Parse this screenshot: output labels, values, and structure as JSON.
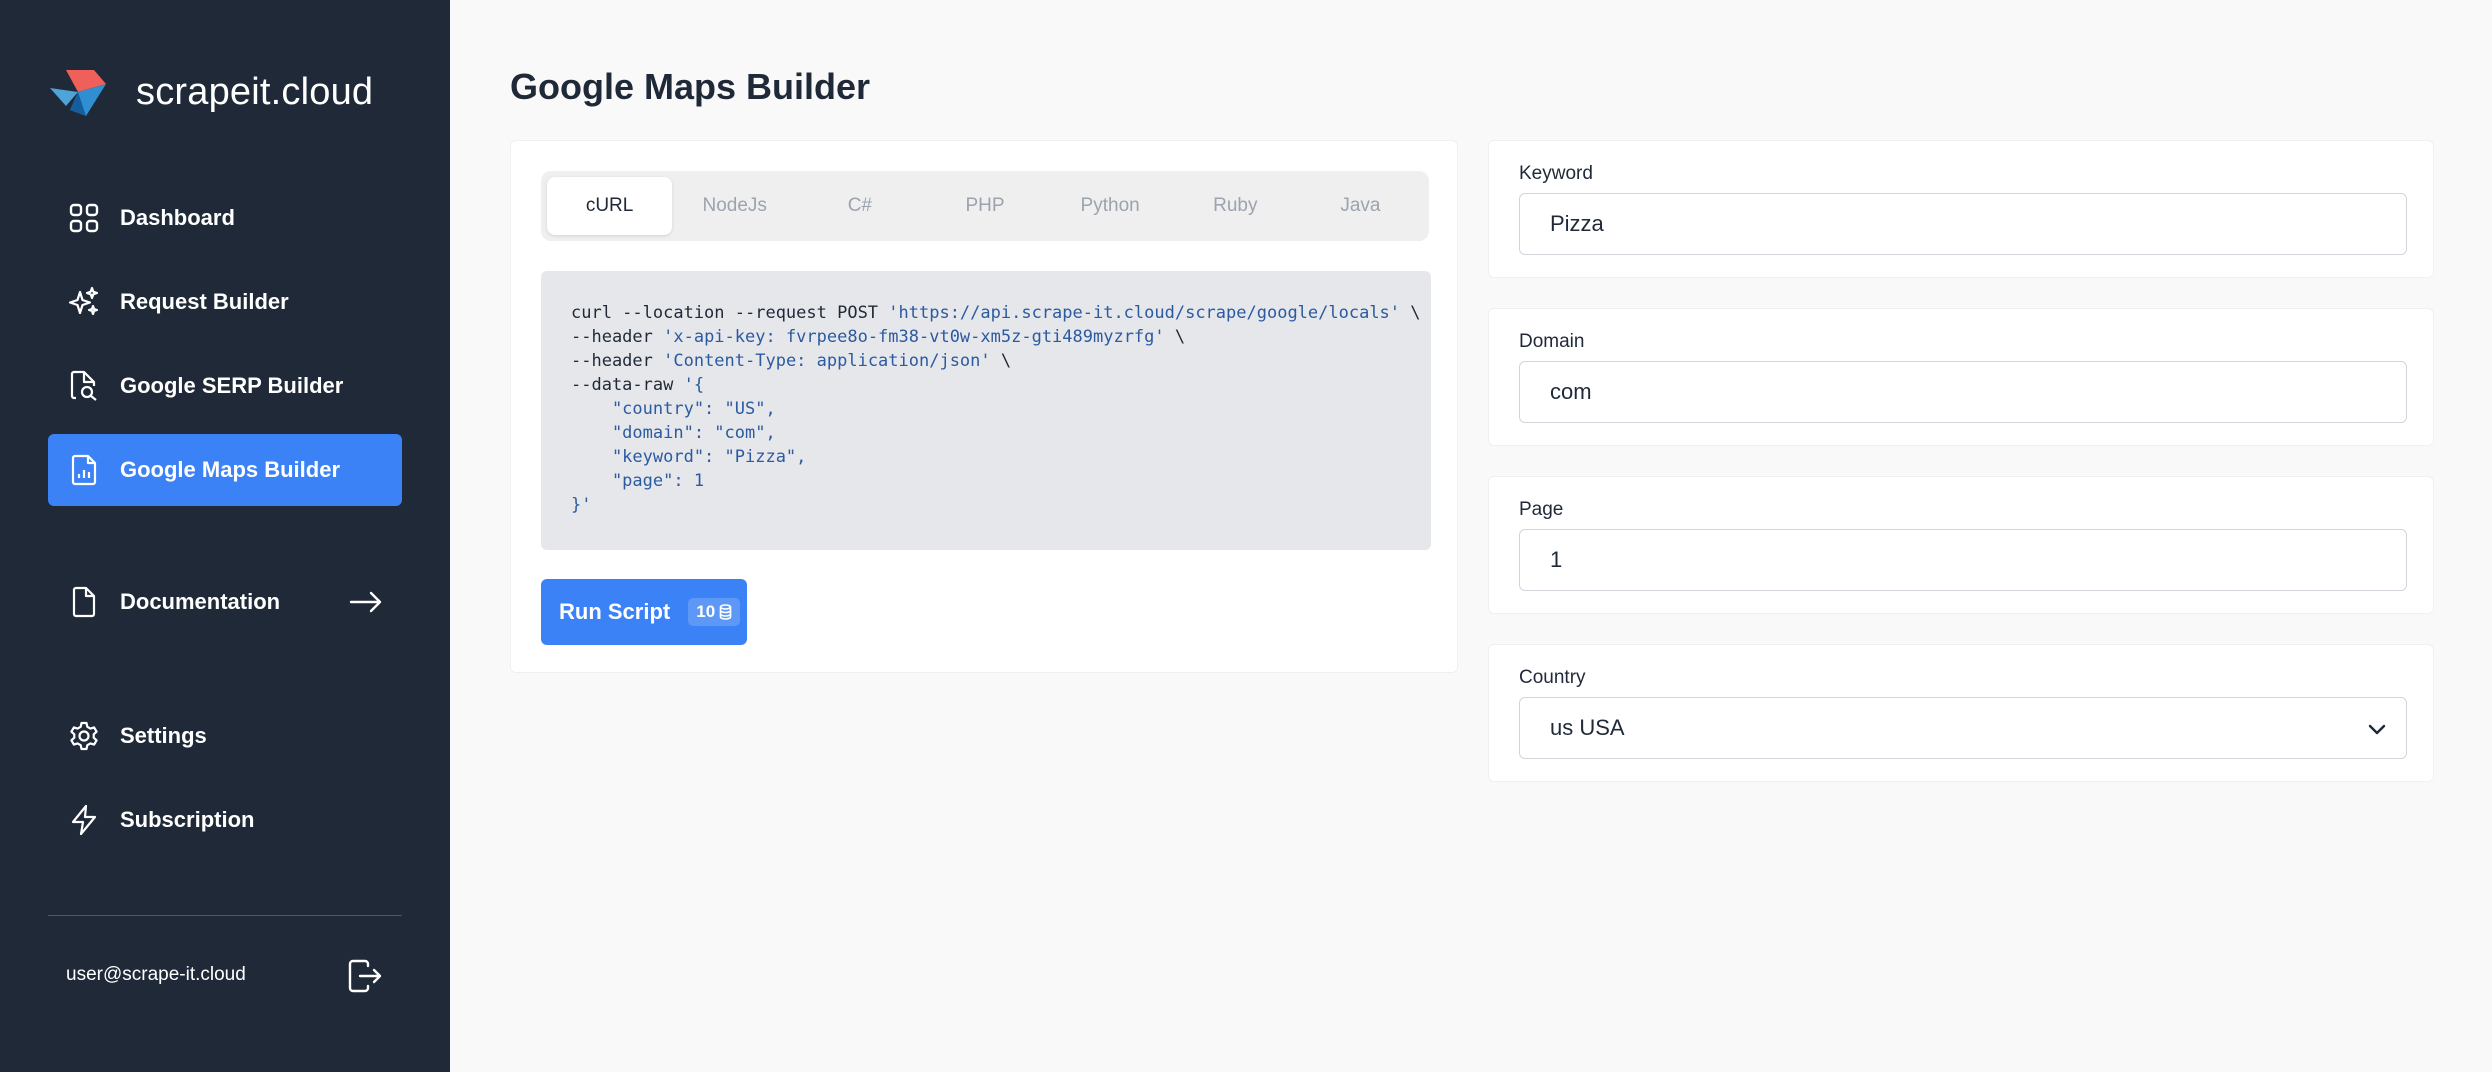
{
  "brand": {
    "name": "scrapeit.cloud"
  },
  "sidebar": {
    "items": [
      {
        "label": "Dashboard",
        "icon": "grid-icon"
      },
      {
        "label": "Request Builder",
        "icon": "sparkles-icon"
      },
      {
        "label": "Google SERP Builder",
        "icon": "document-search-icon"
      },
      {
        "label": "Google Maps Builder",
        "icon": "document-chart-icon",
        "active": true
      },
      {
        "label": "Documentation",
        "icon": "document-icon"
      },
      {
        "label": "Settings",
        "icon": "gear-icon"
      },
      {
        "label": "Subscription",
        "icon": "lightning-icon"
      }
    ],
    "user_email": "user@scrape-it.cloud"
  },
  "page": {
    "title": "Google Maps Builder"
  },
  "tabs": [
    {
      "label": "cURL",
      "active": true
    },
    {
      "label": "NodeJs"
    },
    {
      "label": "C#"
    },
    {
      "label": "PHP"
    },
    {
      "label": "Python"
    },
    {
      "label": "Ruby"
    },
    {
      "label": "Java"
    }
  ],
  "code": {
    "l1_cmd": "curl --location --request POST ",
    "l1_url": "'https://api.scrape-it.cloud/scrape/google/locals'",
    "l1_end": " \\",
    "l2_cmd": "--header ",
    "l2_val": "'x-api-key: fvrpee8o-fm38-vt0w-xm5z-gti489myzrfg'",
    "l2_end": " \\",
    "l3_cmd": "--header ",
    "l3_val": "'Content-Type: application/json'",
    "l3_end": " \\",
    "l4_cmd": "--data-raw ",
    "l4_val": "'{",
    "l5": "    \"country\": \"US\",",
    "l6": "    \"domain\": \"com\",",
    "l7": "    \"keyword\": \"Pizza\",",
    "l8": "    \"page\": 1",
    "l9": "}'"
  },
  "run_button": {
    "label": "Run Script",
    "credits": "10"
  },
  "fields": {
    "keyword": {
      "label": "Keyword",
      "value": "Pizza"
    },
    "domain": {
      "label": "Domain",
      "value": "com"
    },
    "page": {
      "label": "Page",
      "value": "1"
    },
    "country": {
      "label": "Country",
      "value": "us USA"
    }
  },
  "colors": {
    "sidebar_bg": "#1f2937",
    "accent": "#3b82f6",
    "page_bg": "#f9f9f9"
  }
}
